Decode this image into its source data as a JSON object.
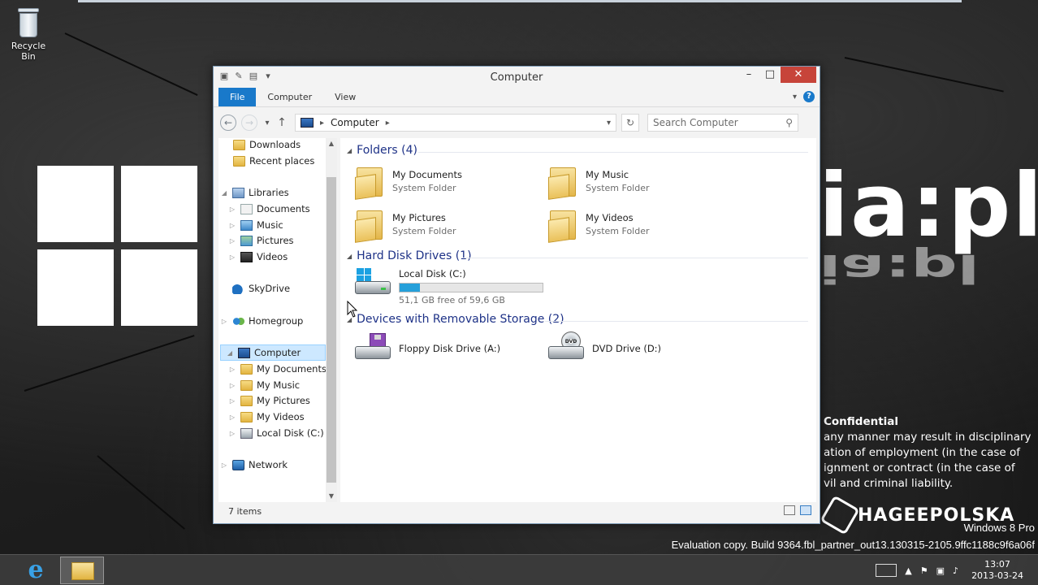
{
  "desktop": {
    "recycle_bin_label": "Recycle Bin",
    "brand_text": "ia:pl",
    "confidential": {
      "heading": "Confidential",
      "lines": [
        "any manner may result in disciplinary",
        "ation of employment (in the case of",
        "ignment or contract (in the case of",
        "vil and criminal liability."
      ]
    },
    "watermark_logo_text": "HAGEEPOLSKA",
    "edition": "Windows 8 Pro",
    "evaluation": "Evaluation copy. Build 9364.fbl_partner_out13.130315-2105.9ffc1188c9f6a06f"
  },
  "window": {
    "title": "Computer",
    "buttons": {
      "minimize": "–",
      "maximize": "□",
      "close": "✕"
    },
    "ribbon": {
      "tabs": [
        "File",
        "Computer",
        "View"
      ],
      "help": "?"
    },
    "address": {
      "path": "Computer",
      "search_placeholder": "Search Computer"
    },
    "nav": {
      "downloads": "Downloads",
      "recent": "Recent places",
      "libraries": "Libraries",
      "documents": "Documents",
      "music": "Music",
      "pictures": "Pictures",
      "videos": "Videos",
      "skydrive": "SkyDrive",
      "homegroup": "Homegroup",
      "computer": "Computer",
      "my_documents": "My Documents",
      "my_music": "My Music",
      "my_pictures": "My Pictures",
      "my_videos": "My Videos",
      "local_disk": "Local Disk (C:)",
      "network": "Network"
    },
    "groups": {
      "folders": "Folders (4)",
      "hard_disks": "Hard Disk Drives (1)",
      "removable": "Devices with Removable Storage (2)"
    },
    "folders": [
      {
        "name": "My Documents",
        "type": "System Folder"
      },
      {
        "name": "My Music",
        "type": "System Folder"
      },
      {
        "name": "My Pictures",
        "type": "System Folder"
      },
      {
        "name": "My Videos",
        "type": "System Folder"
      }
    ],
    "local_disk": {
      "name": "Local Disk (C:)",
      "free": "51,1 GB free of 59,6 GB",
      "used_fraction": 0.14
    },
    "removable": [
      {
        "name": "Floppy Disk Drive (A:)"
      },
      {
        "name": "DVD Drive (D:)"
      }
    ],
    "status": "7 items"
  },
  "taskbar": {
    "time": "13:07",
    "date": "2013-03-24"
  }
}
